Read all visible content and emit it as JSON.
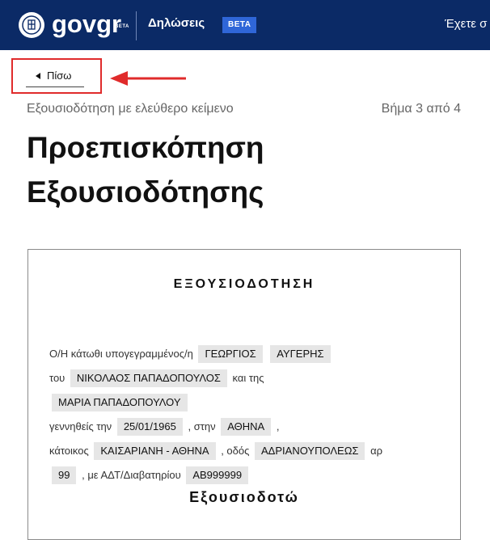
{
  "header": {
    "brand": "govgr",
    "brand_beta": "BETA",
    "app_name": "Δηλώσεις",
    "beta_badge": "BETA",
    "login_text": "Έχετε σ"
  },
  "nav": {
    "back_label": "Πίσω"
  },
  "page": {
    "subtitle": "Εξουσιοδότηση με ελεύθερο κείμενο",
    "step": "Βήμα 3 από 4",
    "title": "Προεπισκόπηση Εξουσιοδότησης"
  },
  "document": {
    "heading": "ΕΞΟΥΣΙΟΔΟΤΗΣΗ",
    "text": {
      "intro": "Ο/Η κάτωθι υπογεγραμμένος/η",
      "father_prefix": "του",
      "mother_prefix": "και της",
      "birth_prefix": "γεννηθείς την",
      "birth_place_prefix": ", στην",
      "comma": ",",
      "residence_prefix": "κάτοικος",
      "street_prefix": ", οδός",
      "number_prefix": "αρ",
      "id_prefix": ", με ΑΔΤ/Διαβατηρίου"
    },
    "fields": {
      "first_name": "ΓΕΩΡΓΙΟΣ",
      "last_name": "ΑΥΓΕΡΗΣ",
      "father_name": "ΝΙΚΟΛΑΟΣ ΠΑΠΑΔΟΠΟΥΛΟΣ",
      "mother_name": "ΜΑΡΙΑ ΠΑΠΑΔΟΠΟΥΛΟΥ",
      "birth_date": "25/01/1965",
      "birth_place": "ΑΘΗΝΑ",
      "residence": "ΚΑΙΣΑΡΙΑΝΗ - ΑΘΗΝΑ",
      "street": "ΑΔΡΙΑΝΟΥΠΟΛΕΩΣ",
      "number": "99",
      "id_number": "ΑΒ999999"
    },
    "section_heading": "Εξουσιοδοτώ"
  },
  "colors": {
    "header_bg": "#0b2a66",
    "beta_badge": "#2f66d8",
    "highlight": "#e02b2b",
    "field_bg": "#e6e6e6"
  }
}
